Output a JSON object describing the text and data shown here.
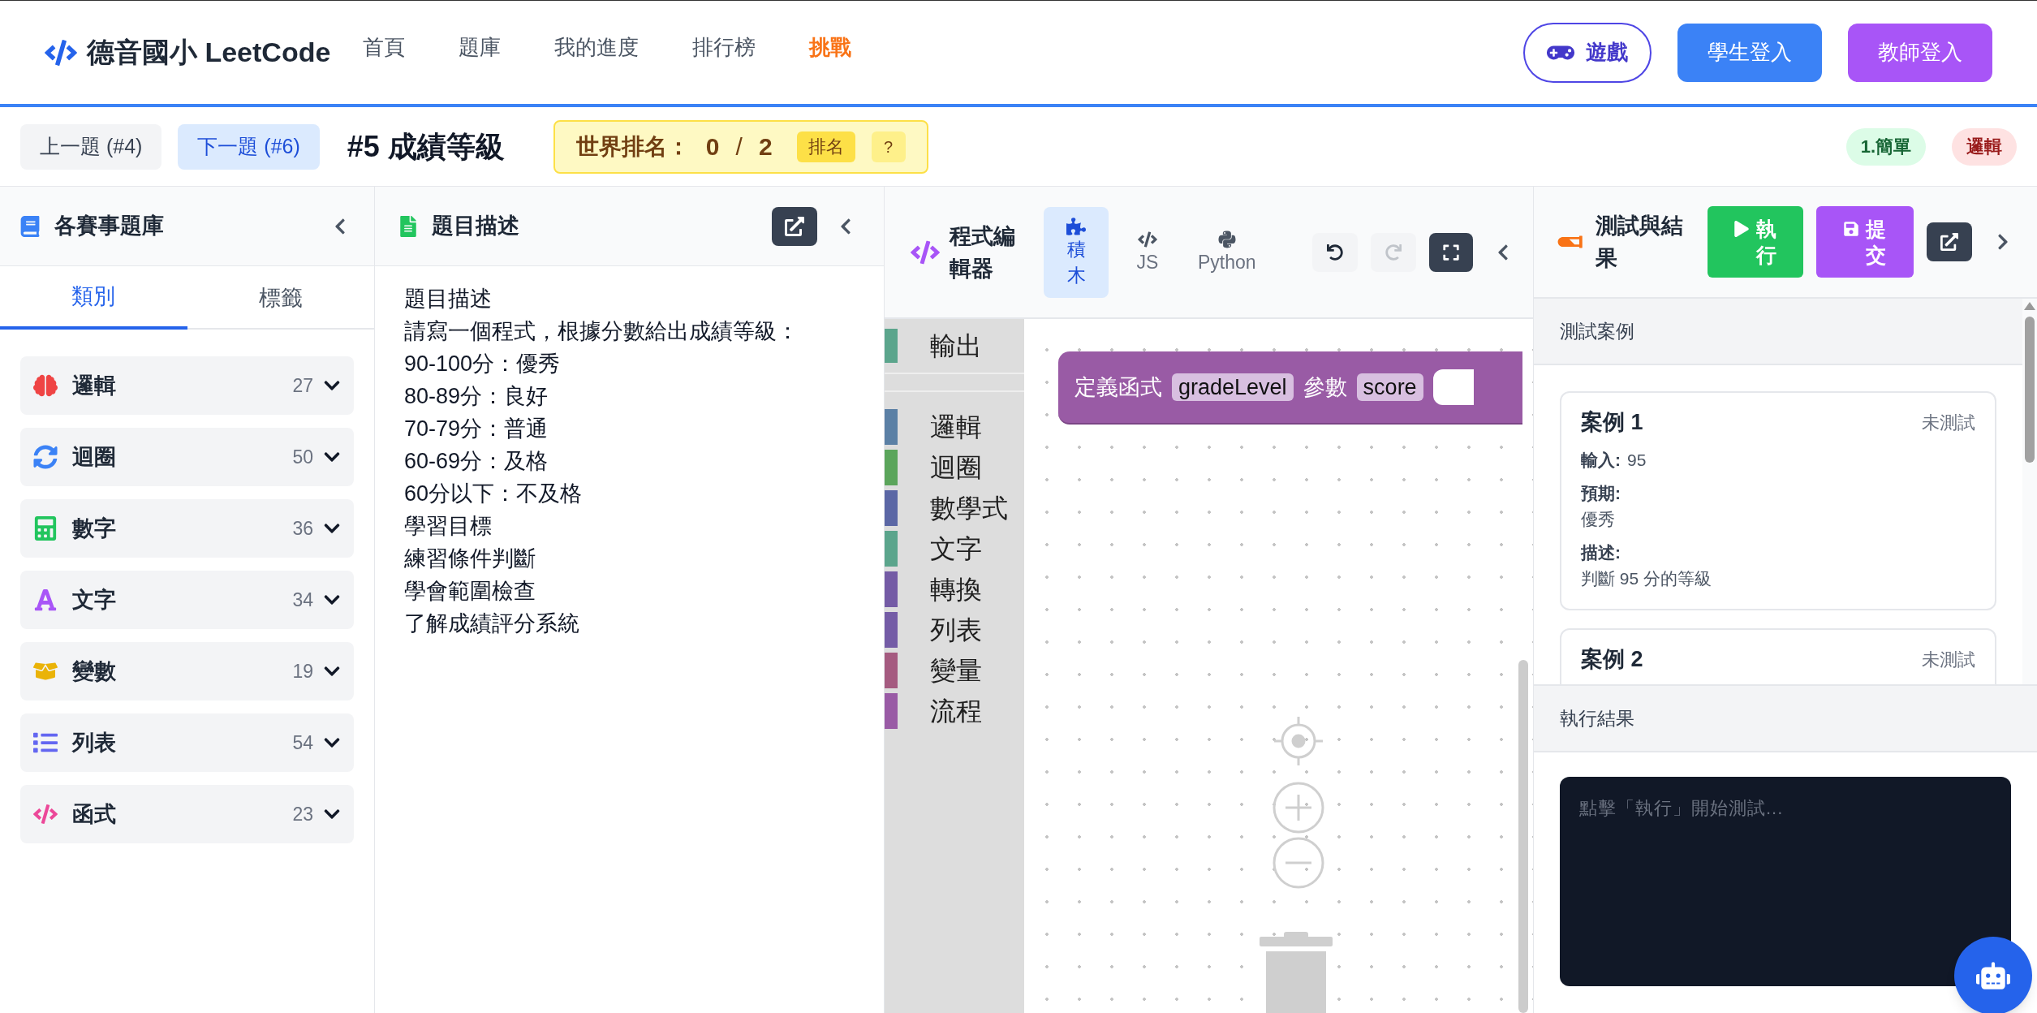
{
  "header": {
    "logo": "德音國小 LeetCode",
    "nav": [
      {
        "label": "首頁",
        "highlighted": false
      },
      {
        "label": "題庫",
        "highlighted": false
      },
      {
        "label": "我的進度",
        "highlighted": false
      },
      {
        "label": "排行榜",
        "highlighted": false
      },
      {
        "label": "挑戰",
        "highlighted": true
      }
    ],
    "game_button": "遊戲",
    "student_login": "學生登入",
    "teacher_login": "教師登入"
  },
  "problem_bar": {
    "prev": "上一題 (#4)",
    "next": "下一題 (#6)",
    "title": "#5 成績等級",
    "ranking": {
      "label": "世界排名：",
      "value": "0",
      "separator": "/",
      "total": "2",
      "rank_button": "排名",
      "help_button": "?"
    },
    "tags": [
      {
        "label": "1.簡單",
        "kind": "difficulty",
        "color": "#dcfce7"
      },
      {
        "label": "邏輯",
        "kind": "category",
        "color": "#fee2e2"
      }
    ]
  },
  "bank": {
    "title": "各賽事題庫",
    "tabs": [
      {
        "label": "類別",
        "selected": true
      },
      {
        "label": "標籤",
        "selected": false
      }
    ],
    "categories": [
      {
        "kind": "logic",
        "label": "邏輯",
        "count": "27",
        "expanded": false
      },
      {
        "kind": "loop",
        "label": "迴圈",
        "count": "50",
        "expanded": false
      },
      {
        "kind": "number",
        "label": "數字",
        "count": "36",
        "expanded": false
      },
      {
        "kind": "text",
        "label": "文字",
        "count": "34",
        "expanded": false
      },
      {
        "kind": "variable",
        "label": "變數",
        "count": "19",
        "expanded": false
      },
      {
        "kind": "list",
        "label": "列表",
        "count": "54",
        "expanded": false
      },
      {
        "kind": "function",
        "label": "函式",
        "count": "23",
        "expanded": false
      }
    ]
  },
  "description": {
    "title": "題目描述",
    "lines": [
      "題目描述",
      "請寫一個程式，根據分數給出成績等級：",
      "90-100分：優秀",
      "80-89分：良好",
      "70-79分：普通",
      "60-69分：及格",
      "60分以下：不及格",
      "學習目標",
      "練習條件判斷",
      "學會範圍檢查",
      "了解成績評分系統"
    ]
  },
  "editor": {
    "title": "程式編輯器",
    "modes": [
      {
        "kind": "blocks",
        "label": "積木",
        "selected": true
      },
      {
        "kind": "js",
        "label": "JS",
        "selected": false
      },
      {
        "kind": "python",
        "label": "Python",
        "selected": false
      }
    ],
    "undo": {
      "disabled": false
    },
    "redo": {
      "disabled": true
    },
    "toolbox_top": [
      {
        "label": "輸出",
        "color": "#5ba58c"
      }
    ],
    "toolbox": [
      {
        "label": "邏輯",
        "color": "#5b80a5"
      },
      {
        "label": "迴圈",
        "color": "#5ba55b"
      },
      {
        "label": "數學式",
        "color": "#5b67a5"
      },
      {
        "label": "文字",
        "color": "#5ba58c"
      },
      {
        "label": "轉換",
        "color": "#745ba5"
      },
      {
        "label": "列表",
        "color": "#745ca6"
      },
      {
        "label": "變量",
        "color": "#a55b80"
      },
      {
        "label": "流程",
        "color": "#995ba5"
      }
    ],
    "block": [
      {
        "kind": "label",
        "text": "定義函式"
      },
      {
        "kind": "field",
        "text": "gradeLevel"
      },
      {
        "kind": "label",
        "text": "參數"
      },
      {
        "kind": "field",
        "text": "score"
      }
    ]
  },
  "tests": {
    "title": "測試與結果",
    "run": "執行",
    "submit": "提交",
    "cases_title": "測試案例",
    "cases": [
      {
        "title": "案例 1",
        "status": "未測試",
        "fields": [
          {
            "label": "輸入:",
            "value": "95",
            "kind": "inline"
          },
          {
            "label": "預期:",
            "value": "優秀",
            "kind": "stacked"
          },
          {
            "label": "描述:",
            "value": "判斷 95 分的等級",
            "kind": "stacked"
          }
        ]
      },
      {
        "title": "案例 2",
        "status": "未測試"
      }
    ],
    "results_title": "執行結果",
    "output": {
      "placeholder": "點擊「執行」開始測試..."
    }
  }
}
